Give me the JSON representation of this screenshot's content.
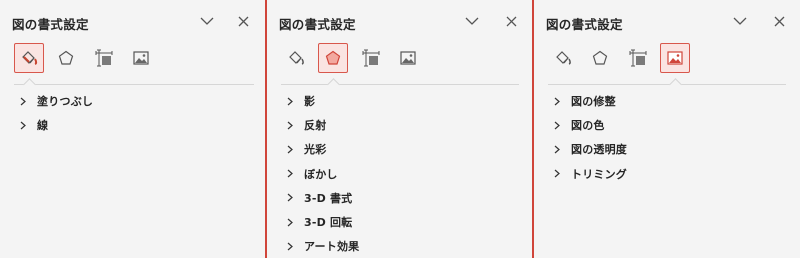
{
  "colors": {
    "accent": "#d0453a",
    "panel_bg": "#f4f4f4",
    "active_tab_bg": "#fae4e2"
  },
  "panes": [
    {
      "title": "図の書式設定",
      "active_tab": "fill-line",
      "tab_icons": [
        "paint-bucket-icon",
        "pentagon-icon",
        "size-properties-icon",
        "picture-icon"
      ],
      "sections": [
        "塗りつぶし",
        "線"
      ]
    },
    {
      "title": "図の書式設定",
      "active_tab": "effects",
      "tab_icons": [
        "paint-bucket-icon",
        "pentagon-icon",
        "size-properties-icon",
        "picture-icon"
      ],
      "sections": [
        "影",
        "反射",
        "光彩",
        "ぼかし",
        "3-D 書式",
        "3-D 回転",
        "アート効果"
      ]
    },
    {
      "title": "図の書式設定",
      "active_tab": "picture",
      "tab_icons": [
        "paint-bucket-icon",
        "pentagon-icon",
        "size-properties-icon",
        "picture-icon"
      ],
      "sections": [
        "図の修整",
        "図の色",
        "図の透明度",
        "トリミング"
      ]
    }
  ]
}
